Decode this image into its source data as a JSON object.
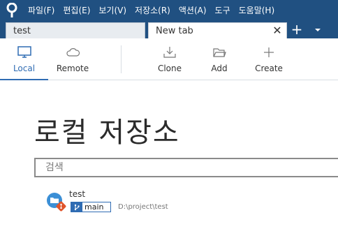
{
  "menu": {
    "items": [
      "파일(F)",
      "편집(E)",
      "보기(V)",
      "저장소(R)",
      "액션(A)",
      "도구",
      "도움말(H)"
    ]
  },
  "tabs": [
    {
      "label": "test"
    },
    {
      "label": "New tab"
    }
  ],
  "tab_controls": {
    "close": "✕",
    "add": "+"
  },
  "toolbar": {
    "local_label": "Local",
    "remote_label": "Remote",
    "clone_label": "Clone",
    "add_label": "Add",
    "create_label": "Create"
  },
  "main": {
    "title": "로컬 저장소",
    "search_placeholder": "검색"
  },
  "repos": [
    {
      "name": "test",
      "branch": "main",
      "path": "D:\\project\\test"
    }
  ],
  "colors": {
    "menubar": "#205081",
    "accent": "#2f6cb3",
    "repo_icon": "#3b8fd6",
    "git_badge": "#e0542b"
  },
  "icons": {
    "app": "sourcetree-logo-icon",
    "local": "monitor-icon",
    "remote": "cloud-icon",
    "clone": "download-tray-icon",
    "add": "folder-open-icon",
    "create": "plus-icon",
    "tab_menu": "chevron-down-icon",
    "repo": "folder-repo-icon",
    "branch": "branch-icon"
  }
}
